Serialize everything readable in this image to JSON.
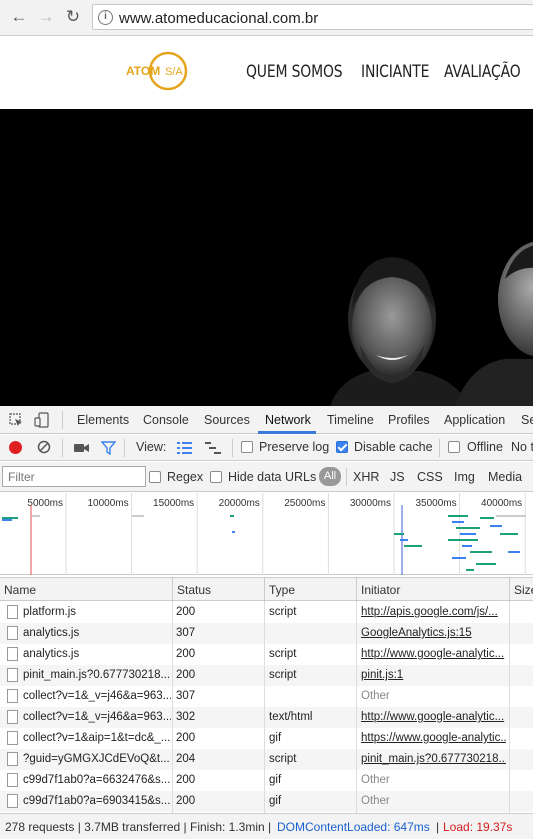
{
  "browser": {
    "url": "www.atomeducacional.com.br"
  },
  "site": {
    "logo_text": "ATOM S/A",
    "brand_color": "#e4a51c",
    "menu": [
      "QUEM SOMOS",
      "INICIANTE",
      "AVALIAÇÃO"
    ]
  },
  "devtools": {
    "tabs": [
      "Elements",
      "Console",
      "Sources",
      "Network",
      "Timeline",
      "Profiles",
      "Application",
      "Se"
    ],
    "active_tab": "Network",
    "toolbar": {
      "view_label": "View:",
      "preserve_log": "Preserve log",
      "preserve_log_checked": false,
      "disable_cache": "Disable cache",
      "disable_cache_checked": true,
      "offline": "Offline",
      "no_throttle": "No t"
    },
    "filter": {
      "placeholder": "Filter",
      "regex": "Regex",
      "hide_data_urls": "Hide data URLs",
      "types": [
        "All",
        "XHR",
        "JS",
        "CSS",
        "Img",
        "Media"
      ]
    },
    "overview_ticks": [
      "5000ms",
      "10000ms",
      "15000ms",
      "20000ms",
      "25000ms",
      "30000ms",
      "35000ms",
      "40000ms"
    ],
    "columns": [
      "Name",
      "Status",
      "Type",
      "Initiator",
      "Size"
    ],
    "rows": [
      {
        "name": "platform.js",
        "status": "200",
        "type": "script",
        "initiator": "http://apis.google.com/js/...",
        "link": true
      },
      {
        "name": "analytics.js",
        "status": "307",
        "type": "",
        "initiator": "GoogleAnalytics.js:15",
        "link": true
      },
      {
        "name": "analytics.js",
        "status": "200",
        "type": "script",
        "initiator": "http://www.google-analytic...",
        "link": true
      },
      {
        "name": "pinit_main.js?0.677730218...",
        "status": "200",
        "type": "script",
        "initiator": "pinit.js:1",
        "link": true
      },
      {
        "name": "collect?v=1&_v=j46&a=963...",
        "status": "307",
        "type": "",
        "initiator": "Other",
        "link": false
      },
      {
        "name": "collect?v=1&_v=j46&a=963...",
        "status": "302",
        "type": "text/html",
        "initiator": "http://www.google-analytic...",
        "link": true
      },
      {
        "name": "collect?v=1&aip=1&t=dc&_...",
        "status": "200",
        "type": "gif",
        "initiator": "https://www.google-analytic...",
        "link": true
      },
      {
        "name": "?guid=yGMGXJCdEVoQ&t...",
        "status": "204",
        "type": "script",
        "initiator": "pinit_main.js?0.677730218...",
        "link": true
      },
      {
        "name": "c99d7f1ab0?a=6632476&s...",
        "status": "200",
        "type": "gif",
        "initiator": "Other",
        "link": false
      },
      {
        "name": "c99d7f1ab0?a=6903415&s...",
        "status": "200",
        "type": "gif",
        "initiator": "Other",
        "link": false
      }
    ],
    "status_bar": {
      "summary": "278 requests | 3.7MB transferred | Finish: 1.3min |",
      "dom_loaded": "DOMContentLoaded: 647ms",
      "dom_color": "#1a5fd0",
      "load": "Load: 19.37s",
      "load_color": "#d42020"
    }
  }
}
